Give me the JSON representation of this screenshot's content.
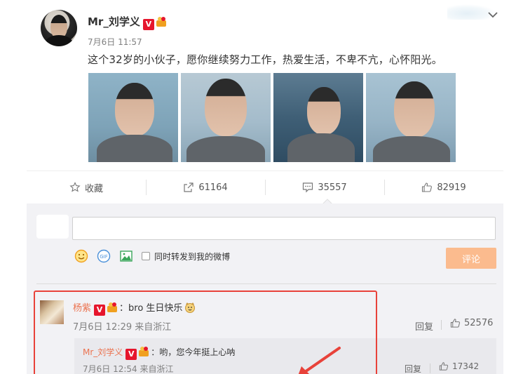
{
  "post": {
    "author": "Mr_刘学义",
    "time": "7月6日 11:57",
    "content": "这个32岁的小伙子，愿你继续努力工作，热爱生活，不卑不亢，心怀阳光。",
    "verified_badge": "V",
    "photos": [
      {
        "icon": "portrait-photo-1"
      },
      {
        "icon": "portrait-photo-2"
      },
      {
        "icon": "portrait-photo-3"
      },
      {
        "icon": "portrait-photo-4"
      }
    ]
  },
  "actions": {
    "favorite_label": "收藏",
    "repost_count": "61164",
    "comment_count": "35557",
    "like_count": "82919"
  },
  "composer": {
    "repost_checkbox_label": "同时转发到我的微博",
    "submit_label": "评论",
    "submit_color": "#fbbb8e"
  },
  "comments": [
    {
      "user": "杨紫",
      "verified_badge": "V",
      "text": "bro 生日快乐",
      "meta": "7月6日 12:29 来自浙江",
      "reply_label": "回复",
      "likes": "52576",
      "replies": [
        {
          "user": "Mr_刘学义",
          "verified_badge": "V",
          "text": "哟，您今年挺上心呐",
          "meta": "7月6日 12:54 来自浙江",
          "reply_label": "回复",
          "likes": "17342"
        }
      ]
    }
  ],
  "colors": {
    "name_link": "#eb7350",
    "verified": "#e6162d",
    "highlight_box": "#e8423a"
  }
}
